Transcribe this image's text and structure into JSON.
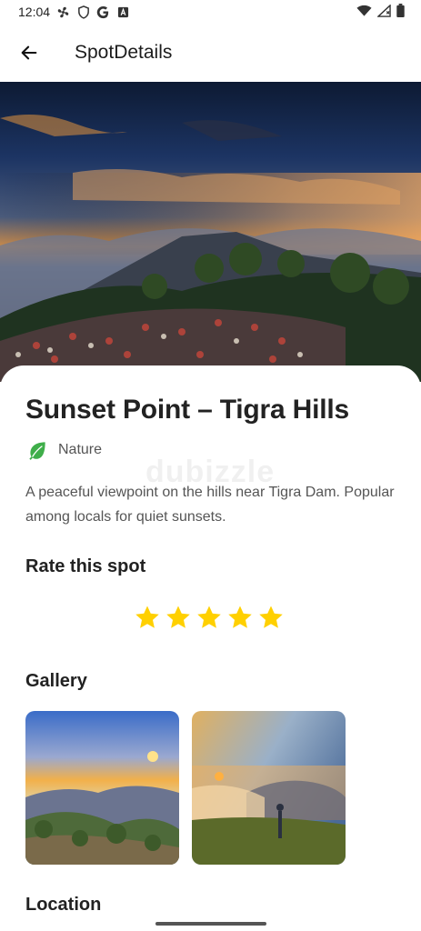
{
  "status_bar": {
    "time": "12:04"
  },
  "app_bar": {
    "title": "SpotDetails"
  },
  "spot": {
    "title": "Sunset Point – Tigra Hills",
    "category": "Nature",
    "description": "A peaceful viewpoint on the hills near Tigra Dam. Popular among locals for quiet sunsets."
  },
  "rating": {
    "title": "Rate this spot",
    "stars": 5,
    "max": 5,
    "star_color": "#FFD000"
  },
  "gallery": {
    "title": "Gallery"
  },
  "location": {
    "title": "Location"
  },
  "watermark": "dubizzle",
  "colors": {
    "category_icon": "#3FAE4A",
    "text_primary": "#222222",
    "text_secondary": "#555555"
  }
}
